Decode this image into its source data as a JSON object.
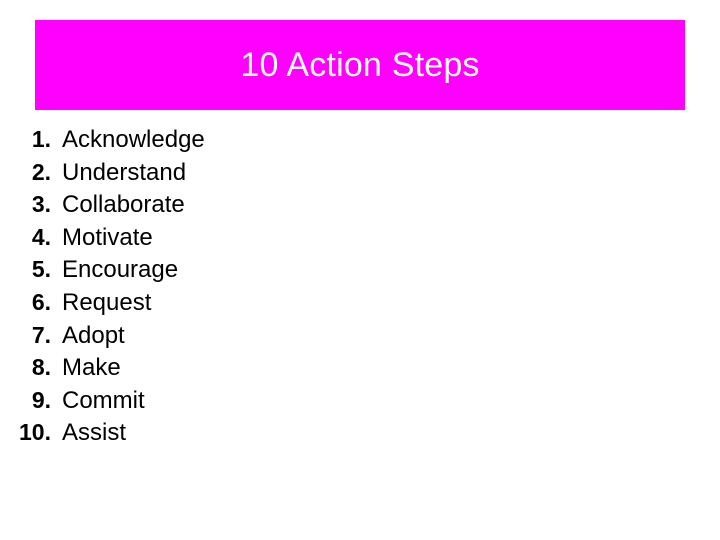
{
  "slide": {
    "background_color": "#FFFFFF",
    "title": {
      "text": "10 Action Steps",
      "banner_color": "#FF00FF",
      "text_color": "#FFFFFF"
    },
    "list": {
      "items": [
        {
          "marker": "1.",
          "label": "Acknowledge"
        },
        {
          "marker": "2.",
          "label": "Understand"
        },
        {
          "marker": "3.",
          "label": "Collaborate"
        },
        {
          "marker": "4.",
          "label": "Motivate"
        },
        {
          "marker": "5.",
          "label": "Encourage"
        },
        {
          "marker": "6.",
          "label": "Request"
        },
        {
          "marker": "7.",
          "label": "Adopt"
        },
        {
          "marker": "8.",
          "label": "Make"
        },
        {
          "marker": "9.",
          "label": "Commit"
        },
        {
          "marker": "10.",
          "label": "Assist"
        }
      ]
    }
  }
}
